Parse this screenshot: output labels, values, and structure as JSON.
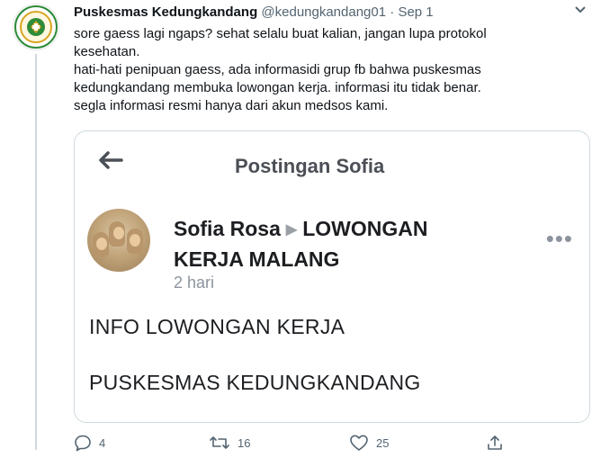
{
  "tweet": {
    "name": "Puskesmas Kedungkandang",
    "handle": "@kedungkandang01",
    "separator": "·",
    "date": "Sep 1",
    "lines": [
      "sore gaess lagi ngaps? sehat selalu buat kalian, jangan lupa protokol",
      "kesehatan.",
      "hati-hati penipuan gaess, ada informasidi grup fb bahwa puskesmas",
      "kedungkandang membuka lowongan kerja. informasi itu tidak benar.",
      "segla informasi resmi hanya dari akun medsos kami."
    ]
  },
  "card": {
    "title": "Postingan Sofia",
    "author": "Sofia Rosa",
    "group": "LOWONGAN",
    "group_line2": "KERJA MALANG",
    "time": "2 hari",
    "line1": "INFO LOWONGAN KERJA",
    "line2": "PUSKESMAS KEDUNGKANDANG"
  },
  "actions": {
    "reply_count": "4",
    "retweet_count": "16",
    "like_count": "25"
  },
  "colors": {
    "text": "#0f1419",
    "secondary": "#536471",
    "border": "#cfd9de",
    "logo_green": "#2e8b3a",
    "logo_gold": "#d8a520"
  },
  "icons": [
    "back-arrow-icon",
    "more-icon",
    "reply-icon",
    "retweet-icon",
    "like-icon",
    "share-icon",
    "chevron-down-icon"
  ]
}
